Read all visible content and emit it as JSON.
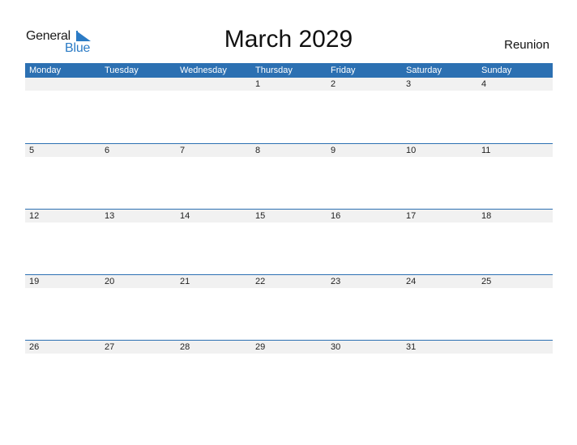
{
  "logo": {
    "line1": "General",
    "line2": "Blue"
  },
  "title": "March 2029",
  "country": "Reunion",
  "colors": {
    "accent": "#2c70b2",
    "logo_blue": "#2b7bc5",
    "day_row_bg": "#f1f1f1"
  },
  "weekdays": [
    "Monday",
    "Tuesday",
    "Wednesday",
    "Thursday",
    "Friday",
    "Saturday",
    "Sunday"
  ],
  "weeks": [
    [
      "",
      "",
      "",
      "1",
      "2",
      "3",
      "4"
    ],
    [
      "5",
      "6",
      "7",
      "8",
      "9",
      "10",
      "11"
    ],
    [
      "12",
      "13",
      "14",
      "15",
      "16",
      "17",
      "18"
    ],
    [
      "19",
      "20",
      "21",
      "22",
      "23",
      "24",
      "25"
    ],
    [
      "26",
      "27",
      "28",
      "29",
      "30",
      "31",
      ""
    ]
  ]
}
